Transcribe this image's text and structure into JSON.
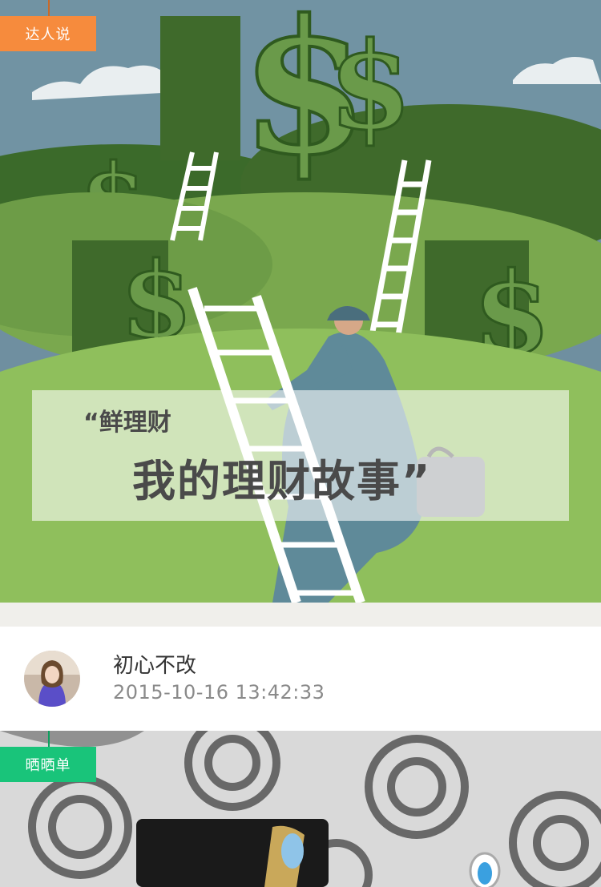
{
  "hero": {
    "category_tag": "达人说",
    "title_line1": "“鲜理财",
    "title_line2": "我的理财故事”",
    "colors": {
      "sky": "#6f8fa0",
      "hill_dark": "#3f6a2b",
      "hill_light": "#8fbf5c",
      "tag": "#f68b3d"
    }
  },
  "post": {
    "author": "初心不改",
    "timestamp": "2015-10-16 13:42:33",
    "avatar_icon": "user-avatar-photo"
  },
  "photo_section": {
    "category_tag": "晒晒单",
    "colors": {
      "tag": "#19c47a"
    }
  }
}
